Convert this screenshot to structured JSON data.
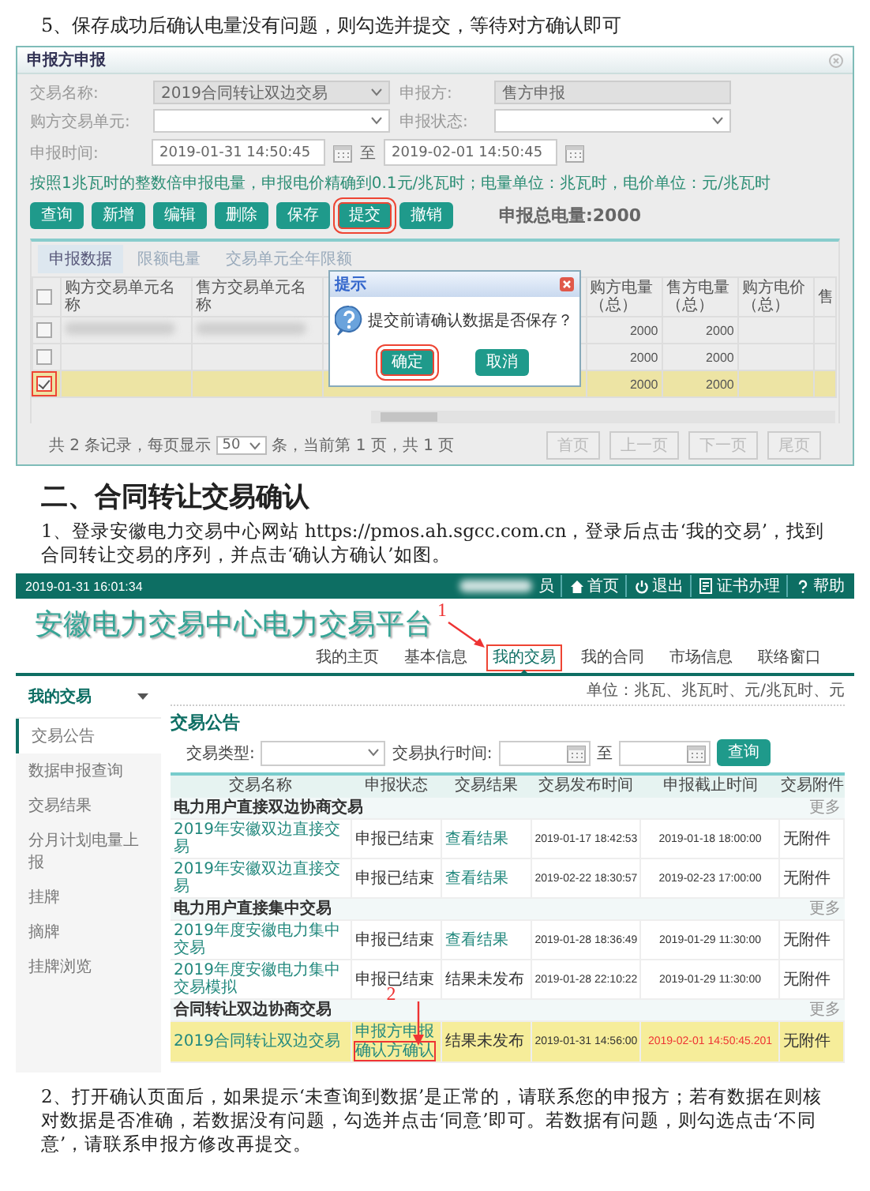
{
  "step5": "5、保存成功后确认电量没有问题，则勾选并提交，等待对方确认即可",
  "declare_window": {
    "title": "申报方申报",
    "form_rows": [
      [
        {
          "label": "交易名称:",
          "value": "2019合同转让双边交易",
          "kind": "select",
          "disabled": true
        },
        {
          "label": "申报方:",
          "value": "售方申报",
          "kind": "text",
          "disabled": true
        }
      ],
      [
        {
          "label": "购方交易单元:",
          "kind": "select",
          "disabled": false
        },
        {
          "label": "申报状态:",
          "kind": "select",
          "disabled": false
        }
      ]
    ],
    "date_range": {
      "label": "申报时间:",
      "from": "2019-01-31 14:50:45",
      "separator": "至",
      "to": "2019-02-01 14:50:45"
    },
    "hint": "按照1兆瓦时的整数倍申报电量，申报电价精确到0.1元/兆瓦时；电量单位：兆瓦时，电价单位：元/兆瓦时",
    "buttons": [
      {
        "label": "查询",
        "annotated": false
      },
      {
        "label": "新增",
        "annotated": false
      },
      {
        "label": "编辑",
        "annotated": false
      },
      {
        "label": "删除",
        "annotated": false
      },
      {
        "label": "保存",
        "annotated": false
      },
      {
        "label": "提交",
        "annotated": true
      },
      {
        "label": "撤销",
        "annotated": false
      }
    ],
    "total": "申报总电量:2000",
    "tabs": [
      {
        "label": "申报数据",
        "selected": true
      },
      {
        "label": "限额电量",
        "selected": false
      },
      {
        "label": "交易单元全年限额",
        "selected": false
      }
    ],
    "grid": {
      "header_checked": false,
      "columns": [
        "购方交易单元名称",
        "售方交易单元名称",
        "购方电量（总）",
        "售方电量（总）",
        "购方电价（总）",
        "售"
      ],
      "rows": [
        {
          "checked": false,
          "selected": false,
          "annotated": false,
          "redacted": true,
          "buy_qty": "2000",
          "sell_qty": "2000"
        },
        {
          "checked": false,
          "selected": false,
          "annotated": false,
          "redacted": false,
          "buy_qty": "2000",
          "sell_qty": "2000"
        },
        {
          "checked": true,
          "selected": true,
          "annotated": true,
          "redacted": false,
          "buy_qty": "2000",
          "sell_qty": "2000"
        }
      ]
    },
    "dialog": {
      "title": "提示",
      "message": "提交前请确认数据是否保存？",
      "buttons": [
        {
          "label": "确定",
          "annotated": true
        },
        {
          "label": "取消",
          "annotated": false
        }
      ]
    },
    "pager": {
      "before": "共 2 条记录，每页显示",
      "page_size": "50",
      "after": "条，当前第 1 页，共 1 页",
      "buttons": [
        {
          "label": "首页",
          "disabled": true
        },
        {
          "label": "上一页",
          "disabled": true
        },
        {
          "label": "下一页",
          "disabled": true
        },
        {
          "label": "尾页",
          "disabled": true
        }
      ]
    }
  },
  "section_heading": "二、合同转让交易确认",
  "paragraph_1": "1、登录安徽电力交易中心网站 https://pmos.ah.sgcc.com.cn，登录后点击‘我的交易’，找到合同转让交易的序列，并点击‘确认方确认’如图。",
  "portal": {
    "top_bar": {
      "time": "2019-01-31 16:01:34",
      "user_redacted": true,
      "user_suffix": "员",
      "links": [
        {
          "label": "首页",
          "kind": "home"
        },
        {
          "label": "退出",
          "kind": "exit"
        },
        {
          "label": "证书办理",
          "kind": "certificate"
        },
        {
          "label": "帮助",
          "kind": "help"
        }
      ]
    },
    "logo": "安徽电力交易中心电力交易平台",
    "nav": [
      {
        "label": "我的主页",
        "selected": false
      },
      {
        "label": "基本信息",
        "selected": false
      },
      {
        "label": "我的交易",
        "selected": true,
        "annotation": "1"
      },
      {
        "label": "我的合同",
        "selected": false
      },
      {
        "label": "市场信息",
        "selected": false
      },
      {
        "label": "联络窗口",
        "selected": false
      }
    ],
    "sidebar": {
      "title": "我的交易",
      "items": [
        {
          "label": "交易公告",
          "selected": true
        },
        {
          "label": "数据申报查询",
          "selected": false
        },
        {
          "label": "交易结果",
          "selected": false
        },
        {
          "label": "分月计划电量上报",
          "selected": false
        },
        {
          "label": "挂牌",
          "selected": false
        },
        {
          "label": "摘牌",
          "selected": false
        },
        {
          "label": "挂牌浏览",
          "selected": false
        }
      ]
    },
    "units": "单位：兆瓦、兆瓦时、元/兆瓦时、元",
    "section_title": "交易公告",
    "filter": {
      "type_label": "交易类型:",
      "time_label": "交易执行时间:",
      "separator": "至",
      "button": "查询"
    },
    "columns": [
      "交易名称",
      "申报状态",
      "交易结果",
      "交易发布时间",
      "申报截止时间",
      "交易附件"
    ],
    "groups": [
      {
        "title": "电力用户直接双边协商交易",
        "more": "更多",
        "rows": [
          {
            "name": "2019年安徽双边直接交易",
            "status": [
              {
                "text": "申报已结束",
                "link": false
              }
            ],
            "result": {
              "text": "查看结果",
              "link": true
            },
            "published": "2019-01-17 18:42:53",
            "deadline": "2019-01-18 18:00:00",
            "overdue": false,
            "attachment": "无附件",
            "selected": false
          },
          {
            "name": "2019年安徽双边直接交易",
            "status": [
              {
                "text": "申报已结束",
                "link": false
              }
            ],
            "result": {
              "text": "查看结果",
              "link": true
            },
            "published": "2019-02-22 18:30:57",
            "deadline": "2019-02-23 17:00:00",
            "overdue": false,
            "attachment": "无附件",
            "selected": false
          }
        ]
      },
      {
        "title": "电力用户直接集中交易",
        "more": "更多",
        "rows": [
          {
            "name": "2019年度安徽电力集中交易",
            "status": [
              {
                "text": "申报已结束",
                "link": false
              }
            ],
            "result": {
              "text": "查看结果",
              "link": true
            },
            "published": "2019-01-28 18:36:49",
            "deadline": "2019-01-29 11:30:00",
            "overdue": false,
            "attachment": "无附件",
            "selected": false
          },
          {
            "name": "2019年度安徽电力集中交易模拟",
            "status": [
              {
                "text": "申报已结束",
                "link": false
              }
            ],
            "result": {
              "text": "结果未发布",
              "link": false
            },
            "published": "2019-01-28 22:10:22",
            "deadline": "2019-01-29 11:30:00",
            "overdue": false,
            "attachment": "无附件",
            "selected": false
          }
        ]
      },
      {
        "title": "合同转让双边协商交易",
        "more": "更多",
        "rows": [
          {
            "name": "2019合同转让双边交易",
            "status": [
              {
                "text": "申报方申报",
                "link": true
              },
              {
                "text": "确认方确认",
                "link": true,
                "annotation": "2"
              }
            ],
            "result": {
              "text": "结果未发布",
              "link": false
            },
            "published": "2019-01-31 14:56:00",
            "deadline": "2019-02-01 14:50:45.201",
            "overdue": true,
            "attachment": "无附件",
            "selected": true
          }
        ]
      }
    ]
  },
  "paragraph_2": "2、打开确认页面后，如果提示‘未查询到数据’是正常的，请联系您的申报方；若有数据在则核对数据是否准确，若数据没有问题，勾选并点击‘同意’即可。若数据有问题，则勾选点击‘不同意’，请联系申报方修改再提交。"
}
